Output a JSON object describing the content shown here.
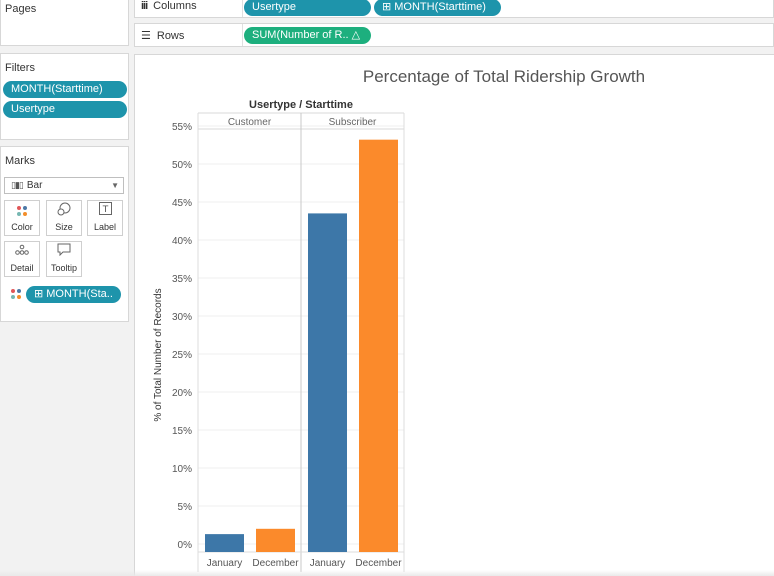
{
  "panels": {
    "pages_title": "Pages",
    "filters_title": "Filters",
    "marks_title": "Marks"
  },
  "filters": [
    "MONTH(Starttime)",
    "Usertype"
  ],
  "marks": {
    "type": "Bar",
    "cards": {
      "color": "Color",
      "size": "Size",
      "label": "Label",
      "detail": "Detail",
      "tooltip": "Tooltip"
    },
    "color_pill": "⊞ MONTH(Sta.."
  },
  "shelves": {
    "columns_label": "Columns",
    "rows_label": "Rows",
    "columns_pills": [
      "Usertype",
      "⊞ MONTH(Starttime)"
    ],
    "rows_pill": "SUM(Number of R..  △"
  },
  "colors": {
    "pill_blue": "#1e94ab",
    "pill_green": "#1daf7e",
    "january": "#3d77a8",
    "december": "#fb8a2b"
  },
  "chart_data": {
    "type": "bar",
    "title": "Percentage of Total Ridership Growth",
    "header_title": "Usertype / Starttime",
    "groups": [
      "Customer",
      "Subscriber"
    ],
    "categories": [
      "January",
      "December"
    ],
    "ylabel": "% of Total Number of Records",
    "ylim": [
      0,
      55
    ],
    "yticks": [
      0,
      5,
      10,
      15,
      20,
      25,
      30,
      35,
      40,
      45,
      50,
      55
    ],
    "tick_suffix": "%",
    "grid": true,
    "series": [
      {
        "group": "Customer",
        "category": "January",
        "value": 1.3
      },
      {
        "group": "Customer",
        "category": "December",
        "value": 2.0
      },
      {
        "group": "Subscriber",
        "category": "January",
        "value": 43.5
      },
      {
        "group": "Subscriber",
        "category": "December",
        "value": 53.2
      }
    ]
  }
}
